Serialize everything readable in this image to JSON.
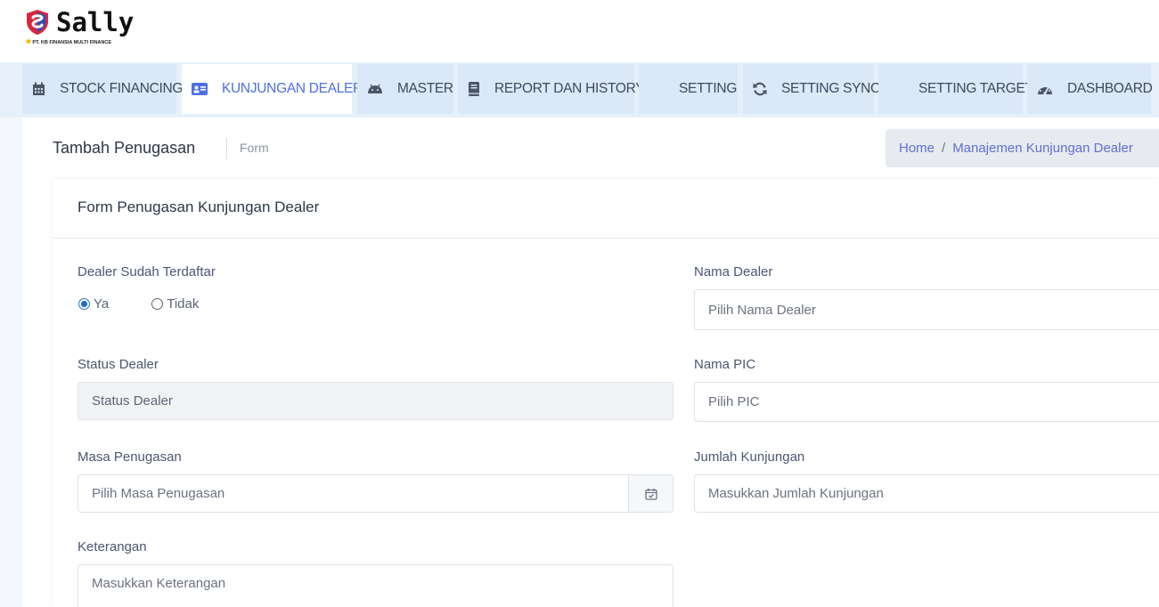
{
  "brand": {
    "name": "Sally",
    "tagline": "PT. KB FINANSIA MULTI FINANCE",
    "colors": {
      "shield_red": "#d7263d",
      "shield_blue": "#2b4fb8"
    }
  },
  "nav": {
    "items": [
      {
        "label": "STOCK FINANCING",
        "icon": "calendar-icon",
        "active": false
      },
      {
        "label": "KUNJUNGAN DEALER",
        "icon": "id-card-icon",
        "active": true
      },
      {
        "label": "MASTER",
        "icon": "android-icon",
        "active": false
      },
      {
        "label": "REPORT DAN HISTORY",
        "icon": "book-icon",
        "active": false
      },
      {
        "label": "SETTING",
        "icon": "",
        "active": false
      },
      {
        "label": "SETTING SYNC",
        "icon": "sync-icon",
        "active": false
      },
      {
        "label": "SETTING TARGET",
        "icon": "",
        "active": false
      },
      {
        "label": "DASHBOARD",
        "icon": "tachometer-icon",
        "active": false
      }
    ],
    "active_color": "#4e6fe0"
  },
  "page": {
    "title": "Tambah Penugasan",
    "subtitle": "Form",
    "breadcrumb": {
      "home": "Home",
      "separator": "/",
      "current": "Manajemen Kunjungan Dealer"
    }
  },
  "form": {
    "title": "Form Penugasan Kunjungan Dealer",
    "dealer_terdaftar": {
      "label": "Dealer Sudah Terdaftar",
      "options": [
        {
          "label": "Ya",
          "checked": true
        },
        {
          "label": "Tidak",
          "checked": false
        }
      ]
    },
    "nama_dealer": {
      "label": "Nama Dealer",
      "placeholder": "Pilih Nama Dealer"
    },
    "status_dealer": {
      "label": "Status Dealer",
      "placeholder": "Status Dealer"
    },
    "nama_pic": {
      "label": "Nama PIC",
      "placeholder": "Pilih PIC"
    },
    "masa_penugasan": {
      "label": "Masa Penugasan",
      "placeholder": "Pilih Masa Penugasan",
      "icon": "calendar-check-icon"
    },
    "jumlah_kunjungan": {
      "label": "Jumlah Kunjungan",
      "placeholder": "Masukkan Jumlah Kunjungan"
    },
    "keterangan": {
      "label": "Keterangan",
      "placeholder": "Masukkan Keterangan"
    }
  }
}
